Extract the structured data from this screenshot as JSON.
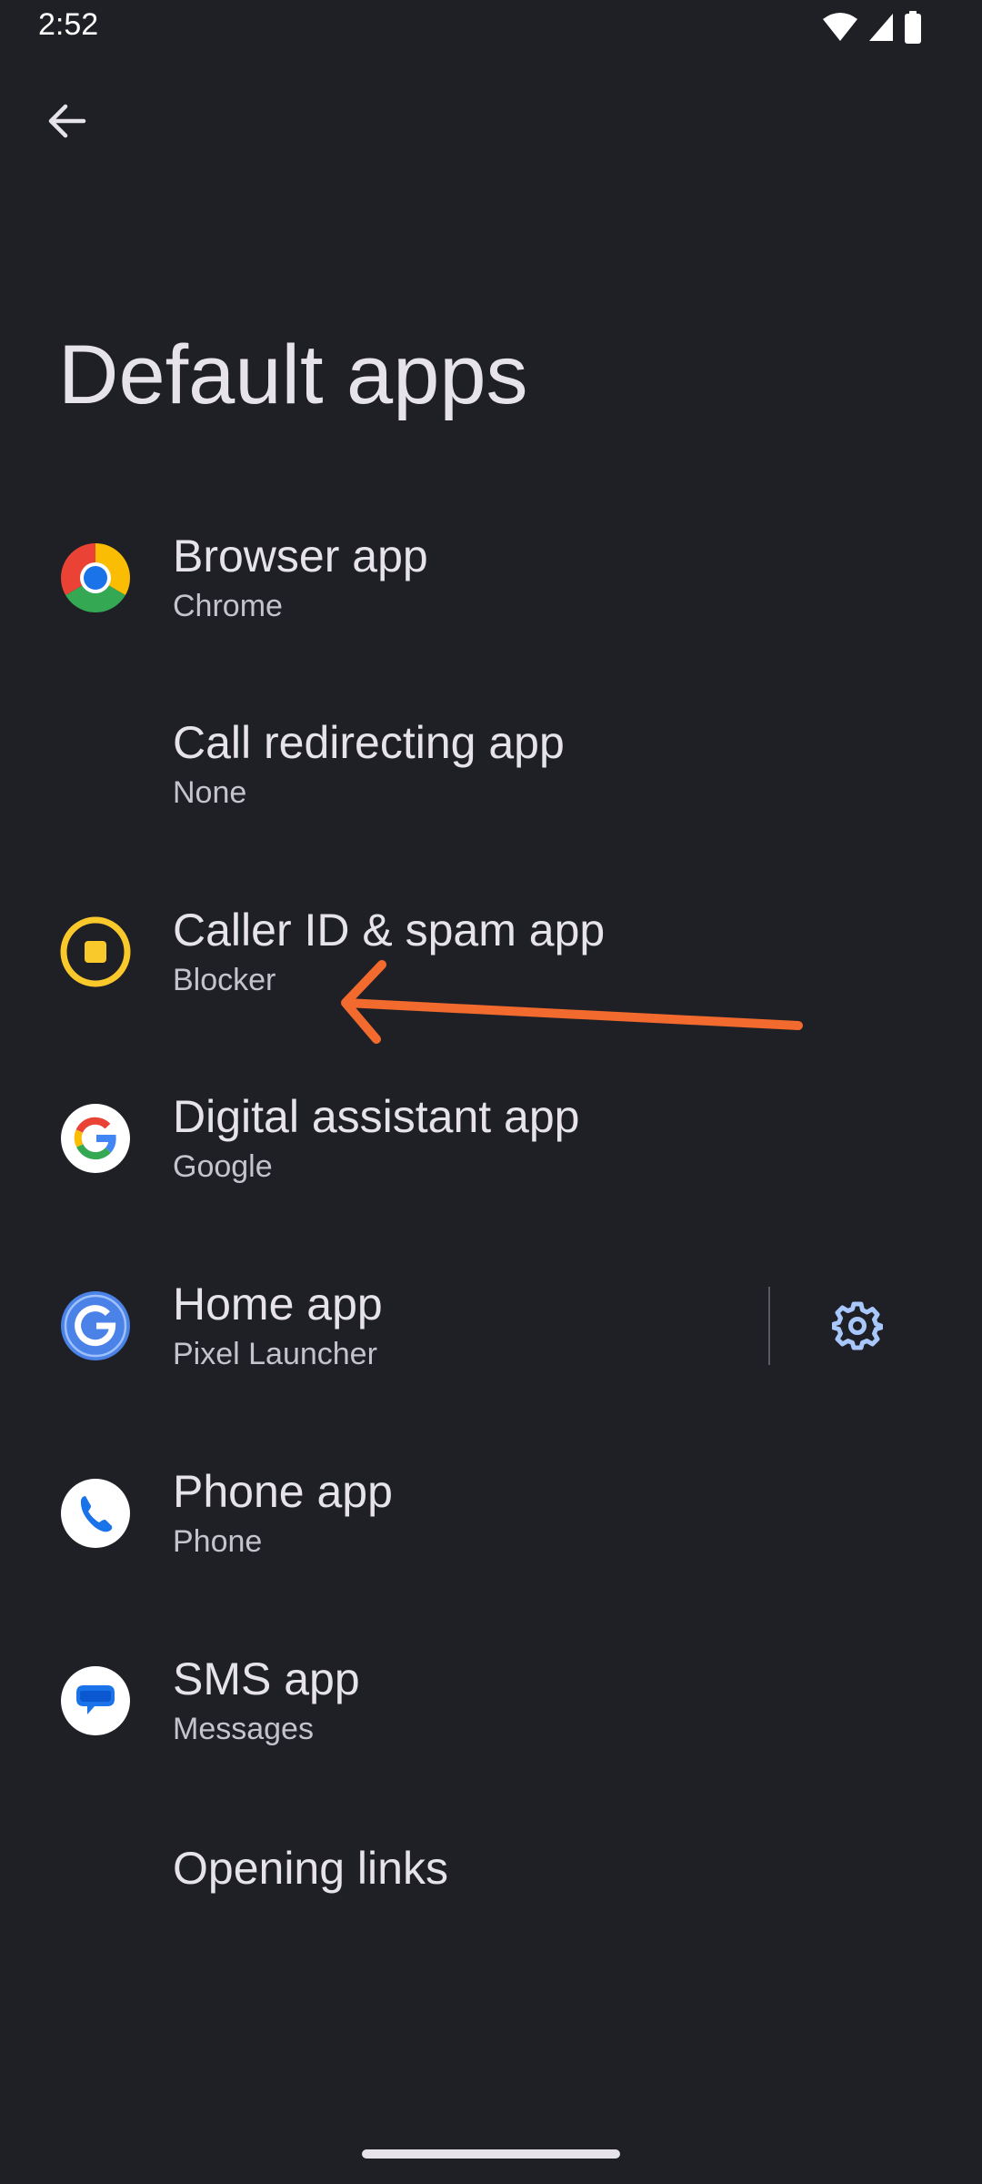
{
  "status_bar": {
    "time": "2:52",
    "icons": [
      "wifi-icon",
      "cell-signal-icon",
      "battery-icon"
    ]
  },
  "header": {
    "back_icon": "arrow-left-icon",
    "title": "Default apps"
  },
  "items": [
    {
      "label": "Browser app",
      "value": "Chrome",
      "icon": "chrome-icon"
    },
    {
      "label": "Call redirecting app",
      "value": "None",
      "icon": null
    },
    {
      "label": "Caller ID & spam app",
      "value": "Blocker",
      "icon": "blocker-icon"
    },
    {
      "label": "Digital assistant app",
      "value": "Google",
      "icon": "google-icon"
    },
    {
      "label": "Home app",
      "value": "Pixel Launcher",
      "icon": "pixel-launcher-icon",
      "action_icon": "gear-icon"
    },
    {
      "label": "Phone app",
      "value": "Phone",
      "icon": "phone-icon"
    },
    {
      "label": "SMS app",
      "value": "Messages",
      "icon": "messages-icon"
    },
    {
      "label": "Opening links",
      "value": null,
      "icon": null
    }
  ],
  "annotation": {
    "icon": "arrow-annotation-icon",
    "color": "#f26a2e"
  },
  "colors": {
    "background": "#1f2026",
    "text_primary": "#e6e4ea",
    "text_secondary": "#c5c3cc",
    "accent": "#a8c7fa"
  }
}
